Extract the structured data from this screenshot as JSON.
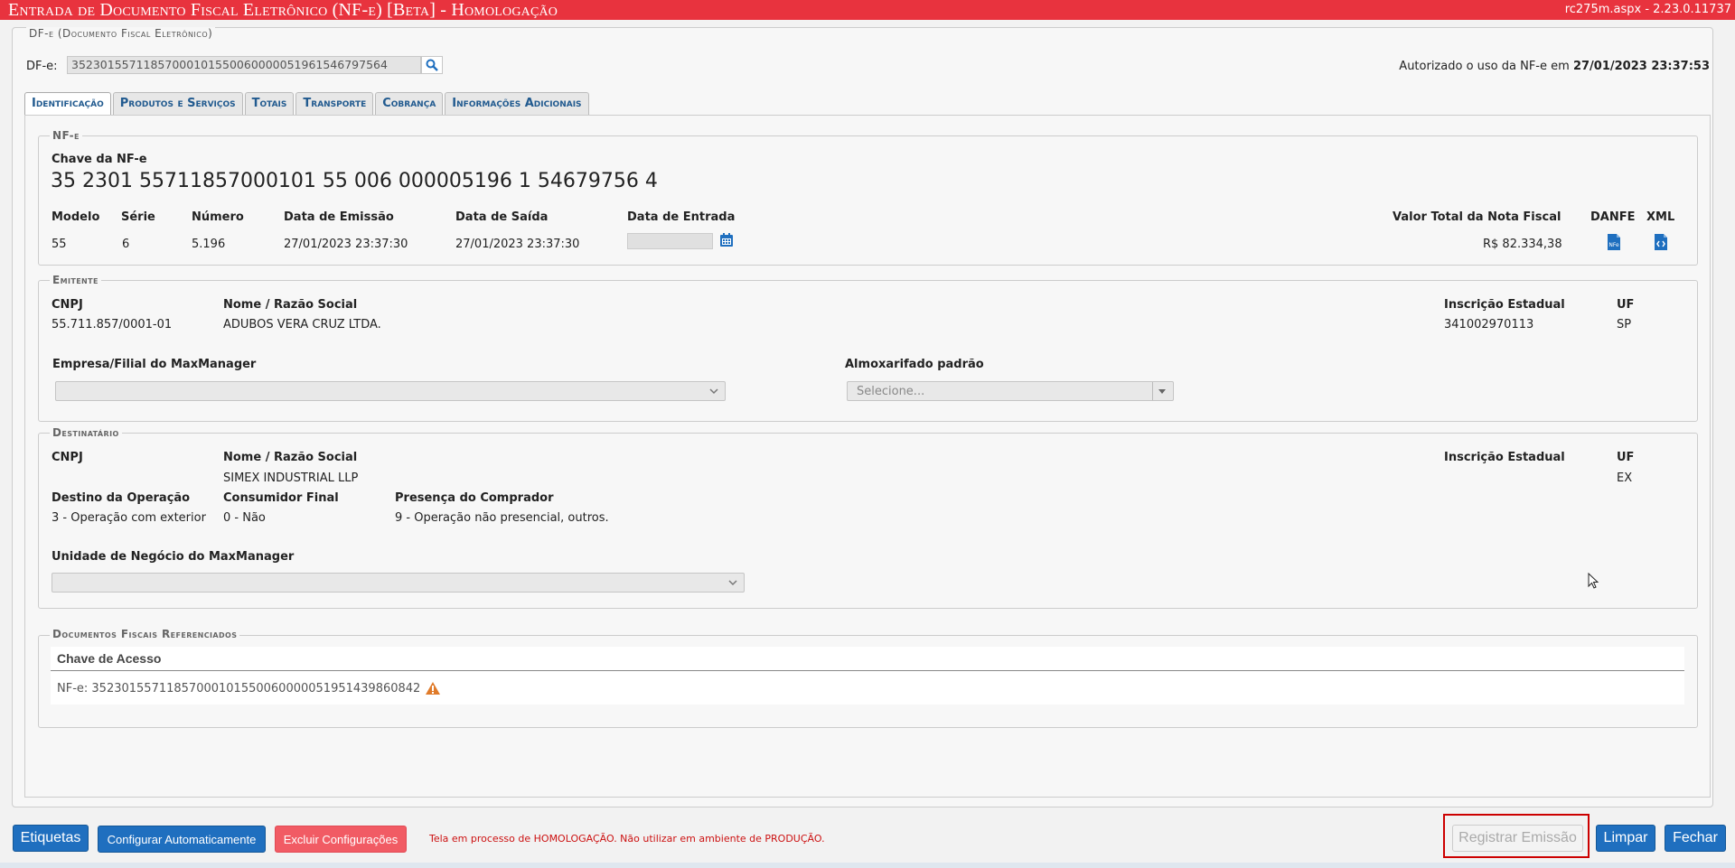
{
  "window": {
    "title": "Entrada de Documento Fiscal Eletrônico (NF-e) [Beta]  - Homologação",
    "version": "rc275m.aspx - 2.23.0.11737"
  },
  "header": {
    "group_legend": "DF-e (Documento Fiscal Eletrônico)",
    "dfe_label": "DF-e:",
    "dfe_value": "35230155711857000101550060000051961546797564",
    "autorizado_prefix": "Autorizado o uso da NF-e em",
    "autorizado_date": "27/01/2023 23:37:53"
  },
  "tabs": [
    {
      "label": "Identificação",
      "active": true
    },
    {
      "label": "Produtos e Serviços",
      "active": false
    },
    {
      "label": "Totais",
      "active": false
    },
    {
      "label": "Transporte",
      "active": false
    },
    {
      "label": "Cobrança",
      "active": false
    },
    {
      "label": "Informações Adicionais",
      "active": false
    }
  ],
  "nfe": {
    "legend": "NF-e",
    "chave_label": "Chave da NF-e",
    "chave_value": "35 2301 55711857000101 55 006 000005196 1 54679756 4",
    "modelo_label": "Modelo",
    "modelo": "55",
    "serie_label": "Série",
    "serie": "6",
    "numero_label": "Número",
    "numero": "5.196",
    "emissao_label": "Data de Emissão",
    "emissao": "27/01/2023 23:37:30",
    "saida_label": "Data de Saída",
    "saida": "27/01/2023 23:37:30",
    "entrada_label": "Data de Entrada",
    "valor_label": "Valor Total da Nota Fiscal",
    "valor": "R$ 82.334,38",
    "danfe_label": "DANFE",
    "xml_label": "XML"
  },
  "emitente": {
    "legend": "Emitente",
    "cnpj_label": "CNPJ",
    "cnpj": "55.711.857/0001-01",
    "nome_label": "Nome / Razão Social",
    "nome": "ADUBOS VERA CRUZ LTDA.",
    "ie_label": "Inscrição Estadual",
    "ie": "341002970113",
    "uf_label": "UF",
    "uf": "SP",
    "empresa_label": "Empresa/Filial do MaxManager",
    "almox_label": "Almoxarifado padrão",
    "almox_placeholder": "Selecione..."
  },
  "destinatario": {
    "legend": "Destinatário",
    "cnpj_label": "CNPJ",
    "nome_label": "Nome / Razão Social",
    "nome": "SIMEX INDUSTRIAL LLP",
    "ie_label": "Inscrição Estadual",
    "uf_label": "UF",
    "uf": "EX",
    "destino_label": "Destino da Operação",
    "destino": "3 - Operação com exterior",
    "consumidor_label": "Consumidor Final",
    "consumidor": "0 - Não",
    "presenca_label": "Presença do Comprador",
    "presenca": "9 - Operação não presencial, outros.",
    "unidade_label": "Unidade de Negócio do MaxManager"
  },
  "referenciados": {
    "legend": "Documentos Fiscais Referenciados",
    "col_header": "Chave de Acesso",
    "row": "NF-e: 35230155711857000101550060000051951439860842"
  },
  "footer": {
    "etiquetas": "Etiquetas",
    "configurar": "Configurar Automaticamente",
    "excluir": "Excluir Configurações",
    "warning": "Tela em processo de HOMOLOGAÇÃO. Não utilizar em ambiente de PRODUÇÃO.",
    "registrar": "Registrar Emissão",
    "limpar": "Limpar",
    "fechar": "Fechar"
  },
  "colors": {
    "titlebar": "#e8333e",
    "primary_button": "#1f6fbf",
    "danger_button": "#f15b64",
    "tab_text": "#215a8f"
  }
}
